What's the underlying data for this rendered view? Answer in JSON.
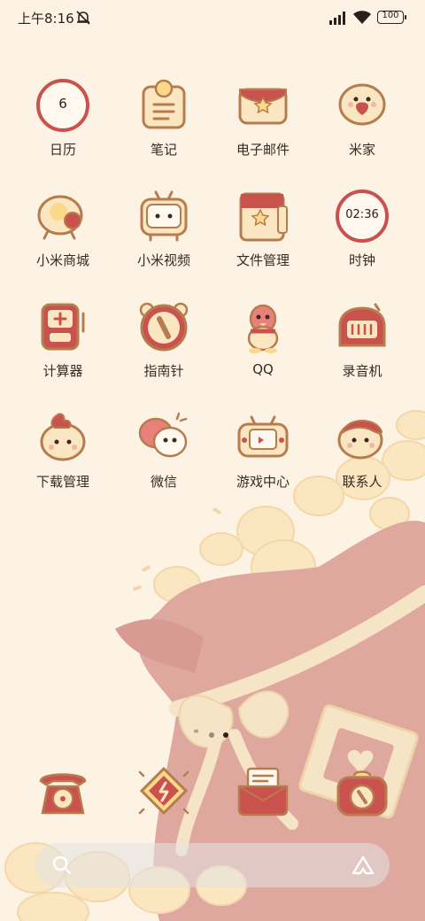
{
  "status_bar": {
    "time": "上午8:16",
    "battery": "100",
    "icons": [
      "mute-icon",
      "signal-icon",
      "wifi-icon",
      "battery-icon"
    ]
  },
  "apps": [
    {
      "label": "日历",
      "icon": "calendar-icon",
      "badge": "6"
    },
    {
      "label": "笔记",
      "icon": "notes-icon"
    },
    {
      "label": "电子邮件",
      "icon": "email-icon"
    },
    {
      "label": "米家",
      "icon": "mijia-icon"
    },
    {
      "label": "小米商城",
      "icon": "mi-store-icon"
    },
    {
      "label": "小米视频",
      "icon": "mi-video-icon"
    },
    {
      "label": "文件管理",
      "icon": "file-manager-icon"
    },
    {
      "label": "时钟",
      "icon": "clock-icon",
      "badge": "02:36"
    },
    {
      "label": "计算器",
      "icon": "calculator-icon"
    },
    {
      "label": "指南针",
      "icon": "compass-icon"
    },
    {
      "label": "QQ",
      "icon": "qq-icon"
    },
    {
      "label": "录音机",
      "icon": "recorder-icon"
    },
    {
      "label": "下载管理",
      "icon": "download-manager-icon"
    },
    {
      "label": "微信",
      "icon": "wechat-icon"
    },
    {
      "label": "游戏中心",
      "icon": "game-center-icon"
    },
    {
      "label": "联系人",
      "icon": "contacts-icon"
    }
  ],
  "dock": [
    {
      "icon": "phone-icon"
    },
    {
      "icon": "themes-icon"
    },
    {
      "icon": "messages-icon"
    },
    {
      "icon": "camera-icon"
    }
  ],
  "page_indicator": {
    "pages": 2,
    "active": 2
  },
  "colors": {
    "background": "#fdf3e4",
    "icon_red": "#c9524f",
    "icon_outline": "#b77c4e",
    "icon_cream": "#fbe6c2",
    "bag_pink": "#dfa89f"
  }
}
